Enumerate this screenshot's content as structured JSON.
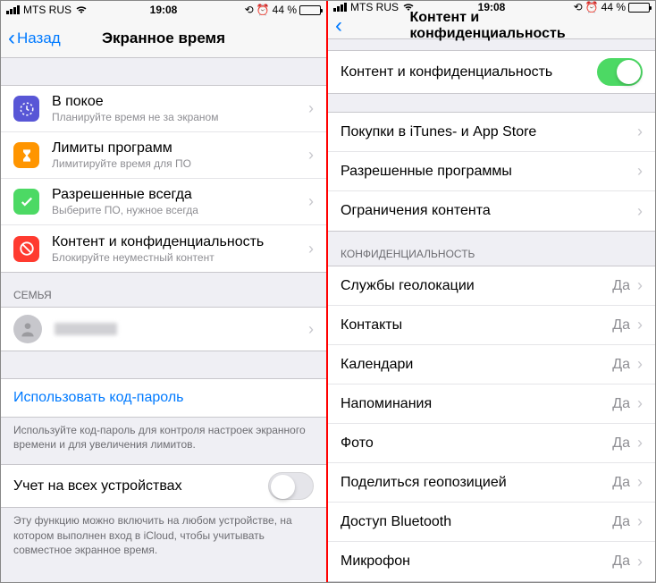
{
  "status": {
    "carrier": "MTS RUS",
    "time": "19:08",
    "battery": "44 %"
  },
  "left": {
    "back": "Назад",
    "title": "Экранное время",
    "items": [
      {
        "title": "В покое",
        "sub": "Планируйте время не за экраном",
        "iconBg": "#5856d6"
      },
      {
        "title": "Лимиты программ",
        "sub": "Лимитируйте время для ПО",
        "iconBg": "#ff9500"
      },
      {
        "title": "Разрешенные всегда",
        "sub": "Выберите ПО, нужное всегда",
        "iconBg": "#4cd964"
      },
      {
        "title": "Контент и конфиденциальность",
        "sub": "Блокируйте неуместный контент",
        "iconBg": "#ff3b30"
      }
    ],
    "familyHeader": "СЕМЬЯ",
    "passcode": "Использовать код-пароль",
    "passcodeFooter": "Используйте код-пароль для контроля настроек экранного времени и для увеличения лимитов.",
    "shareRow": "Учет на всех устройствах",
    "shareFooter": "Эту функцию можно включить на любом устройстве, на котором выполнен вход в iCloud, чтобы учитывать совместное экранное время."
  },
  "right": {
    "title": "Контент и конфиденциальность",
    "mainToggle": "Контент и конфиденциальность",
    "section1": [
      "Покупки в iTunes- и App Store",
      "Разрешенные программы",
      "Ограничения контента"
    ],
    "privacyHeader": "КОНФИДЕНЦИАЛЬНОСТЬ",
    "privacyValue": "Да",
    "privacyRows": [
      "Службы геолокации",
      "Контакты",
      "Календари",
      "Напоминания",
      "Фото",
      "Поделиться геопозицией",
      "Доступ Bluetooth",
      "Микрофон"
    ]
  }
}
